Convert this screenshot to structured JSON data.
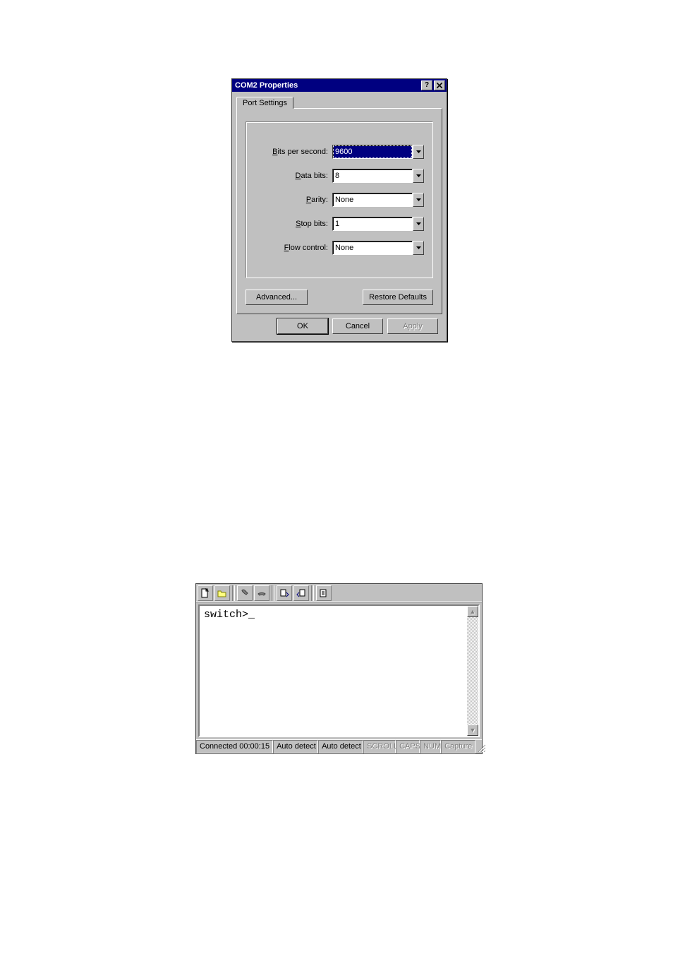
{
  "dialog": {
    "title": "COM2 Properties",
    "tab_label": "Port Settings",
    "fields": {
      "bits_per_second": {
        "label": "Bits per second:",
        "value": "9600"
      },
      "data_bits": {
        "label": "Data bits:",
        "value": "8"
      },
      "parity": {
        "label": "Parity:",
        "value": "None"
      },
      "stop_bits": {
        "label": "Stop bits:",
        "value": "1"
      },
      "flow_control": {
        "label": "Flow control:",
        "value": "None"
      }
    },
    "buttons": {
      "advanced": "Advanced...",
      "restore": "Restore Defaults",
      "ok": "OK",
      "cancel": "Cancel",
      "apply": "Apply"
    }
  },
  "terminal": {
    "toolbar_icons": [
      "new",
      "open",
      "call",
      "hangup",
      "send",
      "receive",
      "properties"
    ],
    "prompt": "switch>_",
    "status": {
      "connected": "Connected 00:00:15",
      "proto": "Auto detect",
      "emul": "Auto detect",
      "scroll": "SCROLL",
      "caps": "CAPS",
      "num": "NUM",
      "capture": "Capture"
    }
  }
}
